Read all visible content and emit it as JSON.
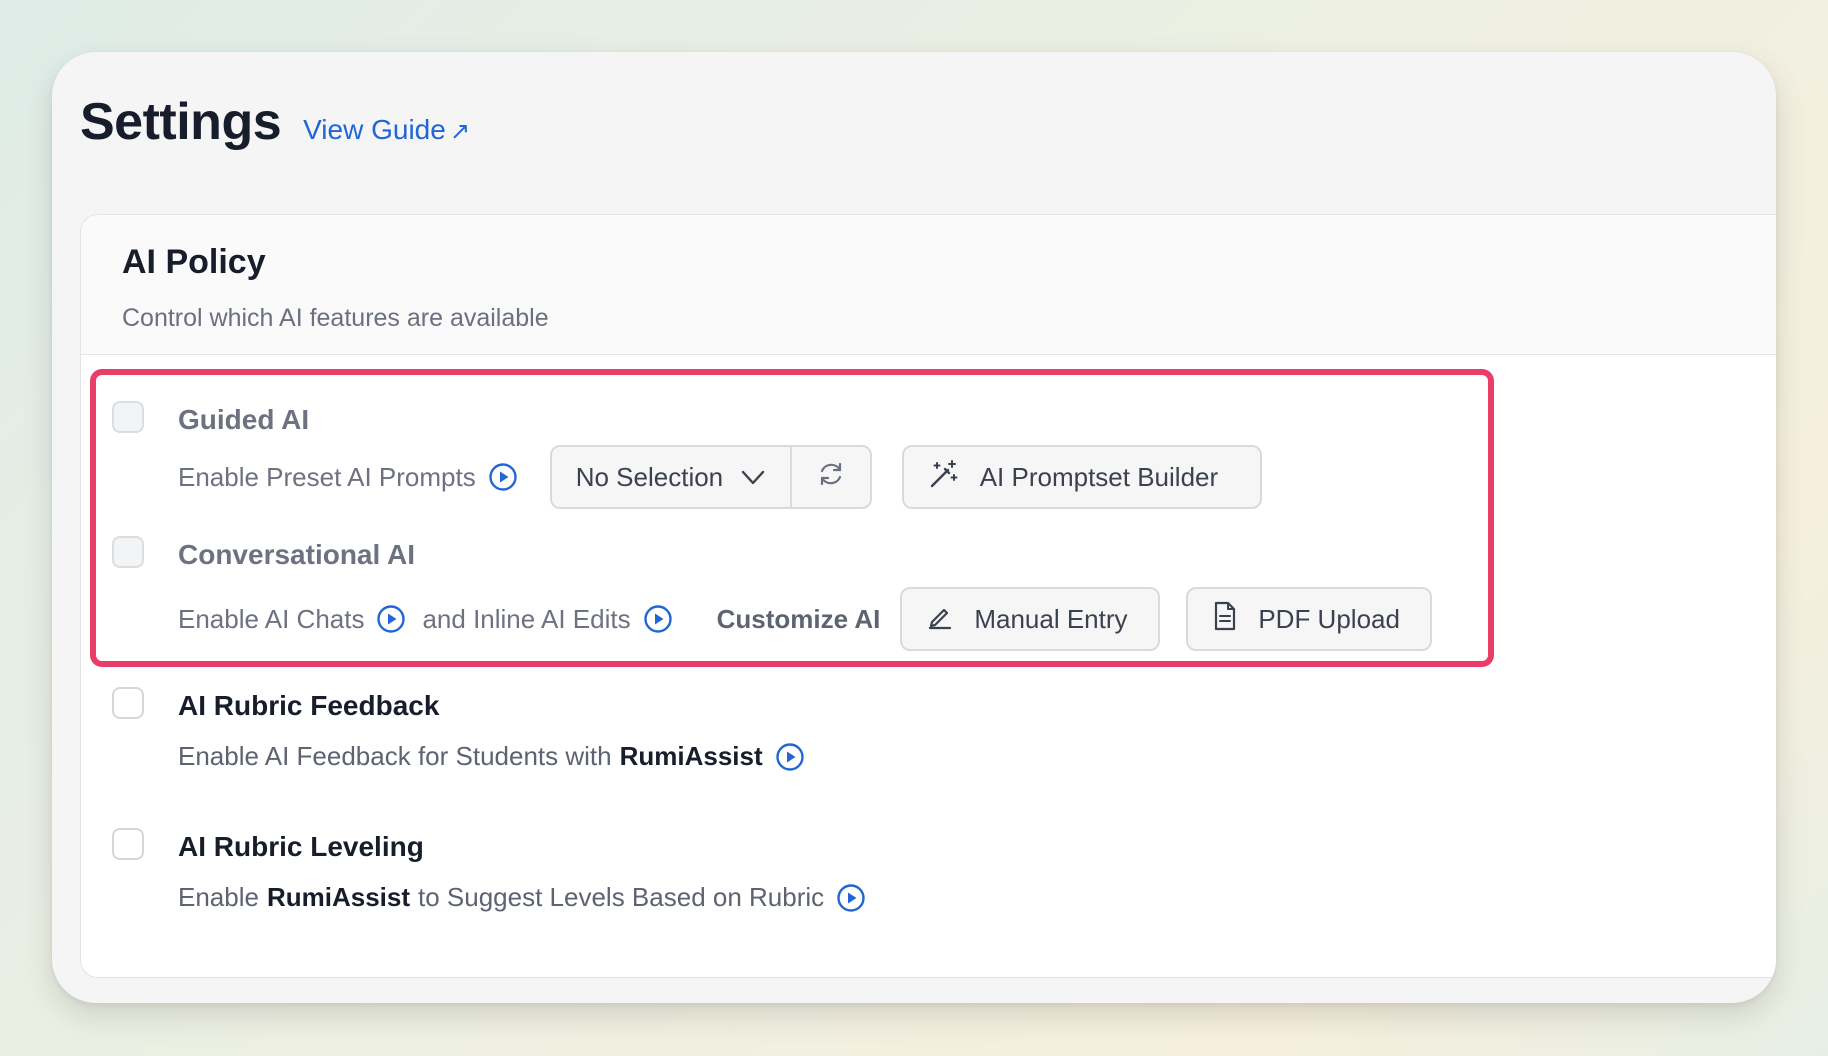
{
  "header": {
    "title": "Settings",
    "guide_link": "View Guide",
    "guide_arrow": "↗"
  },
  "policy": {
    "title": "AI Policy",
    "subtitle": "Control which AI features are available"
  },
  "options": {
    "guided": {
      "title": "Guided AI",
      "desc": "Enable Preset AI Prompts",
      "dropdown_value": "No Selection",
      "builder_button": "AI Promptset Builder",
      "checked": false,
      "disabled": true
    },
    "conversational": {
      "title": "Conversational AI",
      "desc_a": "Enable AI Chats",
      "desc_b": "and Inline AI Edits",
      "customize_label": "Customize AI",
      "manual_button": "Manual Entry",
      "pdf_button": "PDF Upload",
      "checked": false,
      "disabled": true
    },
    "feedback": {
      "title": "AI Rubric Feedback",
      "desc_pre": "Enable AI Feedback for Students with",
      "desc_brand": "RumiAssist",
      "checked": false
    },
    "leveling": {
      "title": "AI Rubric Leveling",
      "desc_pre": "Enable",
      "desc_brand": "RumiAssist",
      "desc_post": "to Suggest Levels Based on Rubric",
      "checked": false
    }
  },
  "colors": {
    "accent": "#2066d6",
    "highlight": "#ea3e68",
    "title": "#171d2b"
  },
  "icons": {
    "play": "play-circle-icon",
    "chevron": "chevron-down-icon",
    "refresh": "refresh-icon",
    "magic": "magic-wand-icon",
    "pencil": "pencil-icon",
    "file": "file-icon",
    "external": "external-link-icon"
  }
}
